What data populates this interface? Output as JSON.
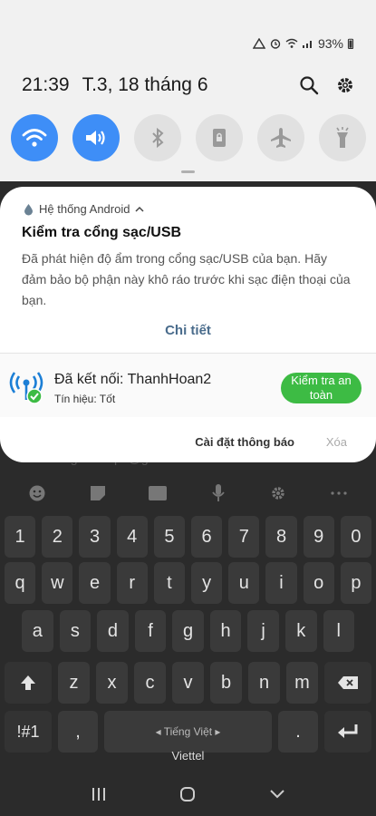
{
  "status_bar": {
    "battery": "93%"
  },
  "header": {
    "time": "21:39",
    "date": "T.3, 18 tháng 6"
  },
  "quick_settings": [
    {
      "name": "wifi",
      "state": "on"
    },
    {
      "name": "sound",
      "state": "on"
    },
    {
      "name": "bluetooth",
      "state": "off"
    },
    {
      "name": "lock-rotation",
      "state": "off"
    },
    {
      "name": "airplane-mode",
      "state": "off"
    },
    {
      "name": "flashlight",
      "state": "off"
    }
  ],
  "notification": {
    "app": "Hệ thống Android",
    "title": "Kiểm tra cổng sạc/USB",
    "body": "Đã phát hiện độ ẩm trong cổng sạc/USB của bạn. Hãy đảm bảo bộ phận này khô ráo trước khi sạc điện thoại của bạn.",
    "detail_label": "Chi tiết"
  },
  "wifi_notification": {
    "title": "Đã kết nối: ThanhHoan2",
    "subtitle": "Tín hiệu: Tốt",
    "button_label": "Kiểm tra an toàn"
  },
  "footer": {
    "settings_label": "Cài đặt thông báo",
    "clear_label": "Xóa"
  },
  "keyboard": {
    "email_ghost": "Thnlcongconcolpu@gmail.com",
    "row1": [
      "1",
      "2",
      "3",
      "4",
      "5",
      "6",
      "7",
      "8",
      "9",
      "0"
    ],
    "row2": [
      "q",
      "w",
      "e",
      "r",
      "t",
      "y",
      "u",
      "i",
      "o",
      "p"
    ],
    "row3": [
      "a",
      "s",
      "d",
      "f",
      "g",
      "h",
      "j",
      "k",
      "l"
    ],
    "row4": [
      "z",
      "x",
      "c",
      "v",
      "b",
      "n",
      "m"
    ],
    "symbols_label": "!#1",
    "comma_label": ",",
    "space_label": "◂ Tiếng Việt ▸",
    "period_label": ".",
    "carrier": "Viettel"
  },
  "colors": {
    "accent": "#3e8ef7",
    "safe_button": "#3dbb44",
    "detail_text": "#4a6c8c"
  }
}
